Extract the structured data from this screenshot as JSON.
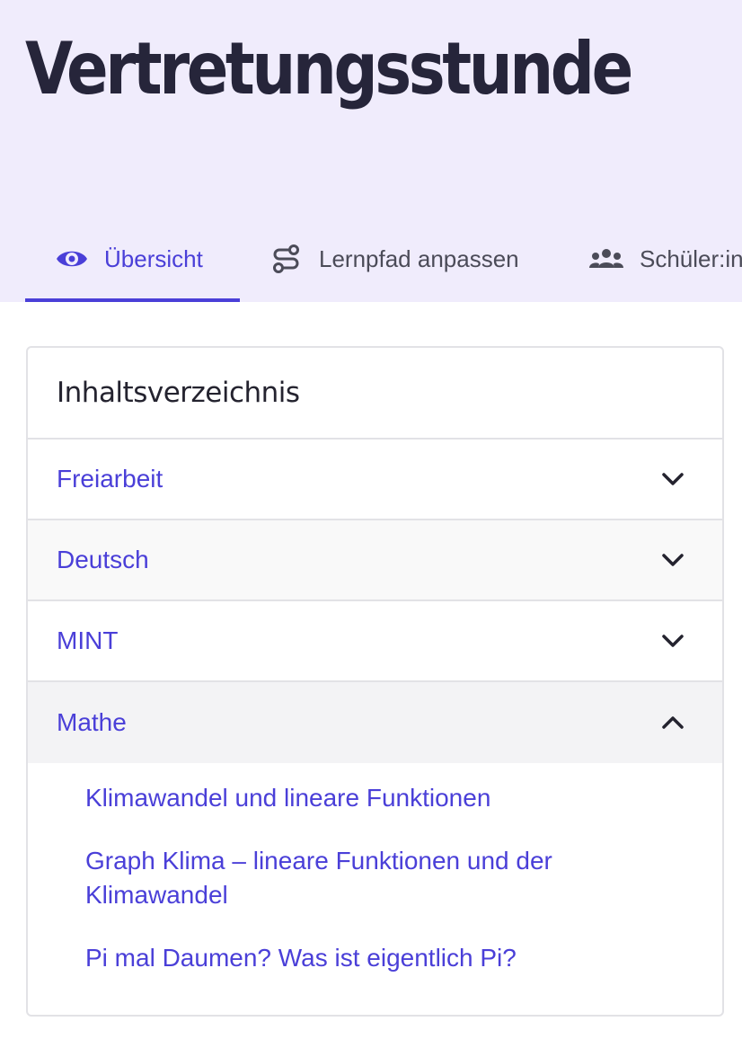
{
  "header": {
    "title": "Vertretungsstunde"
  },
  "tabs": [
    {
      "label": "Übersicht",
      "icon": "eye-icon",
      "active": true
    },
    {
      "label": "Lernpfad anpassen",
      "icon": "route-icon",
      "active": false
    },
    {
      "label": "Schüler:in",
      "icon": "users-icon",
      "active": false
    }
  ],
  "colors": {
    "accent": "#4a3fd8",
    "header_bg": "#f0ecfc",
    "title_text": "#26253a",
    "border": "#e2e2e6"
  },
  "toc": {
    "title": "Inhaltsverzeichnis",
    "sections": [
      {
        "label": "Freiarbeit",
        "expanded": false
      },
      {
        "label": "Deutsch",
        "expanded": false
      },
      {
        "label": "MINT",
        "expanded": false
      },
      {
        "label": "Mathe",
        "expanded": true,
        "items": [
          "Klimawandel und lineare Funktionen",
          "Graph Klima – lineare Funktionen und der Klimawandel",
          "Pi mal Daumen? Was ist eigentlich Pi?"
        ]
      }
    ]
  }
}
